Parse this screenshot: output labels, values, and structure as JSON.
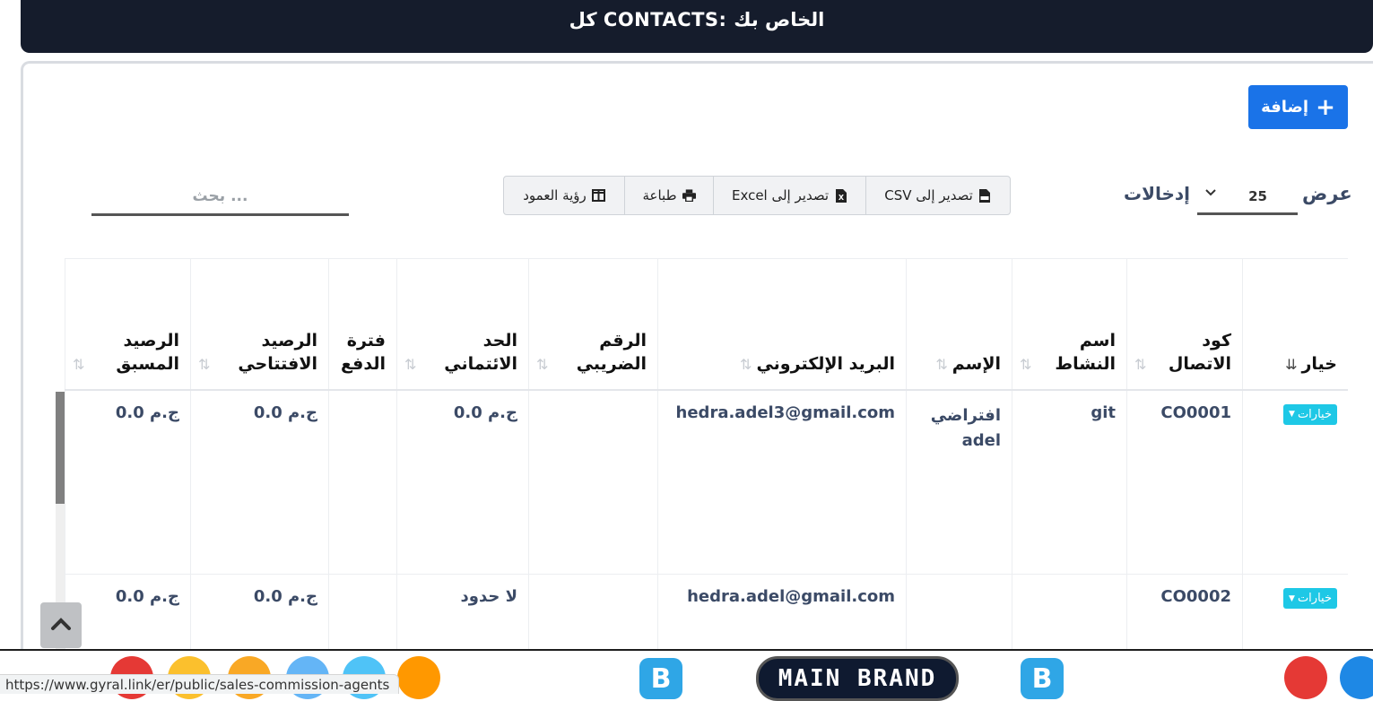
{
  "header": {
    "title": "كل CONTACTS: الخاص بك"
  },
  "toolbar": {
    "add_label": "إضافة",
    "show_label": "عرض",
    "entries_value": "25",
    "entries_label": "إدخالات",
    "export_csv": "تصدير إلى CSV",
    "export_excel": "تصدير إلى Excel",
    "print": "طباعة",
    "column_visibility": "رؤية العمود",
    "search_placeholder": "بحث ..."
  },
  "table": {
    "columns": [
      "خيار",
      "كود الاتصال",
      "اسم النشاط",
      "الإسم",
      "البريد الإلكتروني",
      "الرقم الضريبي",
      "الحد الائتماني",
      "فترة الدفع",
      "الرصيد الافتتاحي",
      "الرصيد المسبق"
    ],
    "options_label": "خيارات",
    "rows": [
      {
        "code": "CO0001",
        "business": "git",
        "name": "افتراضي adel",
        "email": "hedra.adel3@gmail.com",
        "tax": "",
        "credit": "ج.م 0.0",
        "pay_term": "",
        "opening": "ج.م 0.0",
        "advance": "ج.م 0.0"
      },
      {
        "code": "CO0002",
        "business": "",
        "name": "",
        "email": "hedra.adel@gmail.com",
        "tax": "",
        "credit": "لا حدود",
        "pay_term": "",
        "opening": "ج.م 0.0",
        "advance": "ج.م 0.0"
      }
    ]
  },
  "taskbar": {
    "brand": "MAIN BRAND",
    "b_letter": "B"
  },
  "status_url": "https://www.gyral.link/er/public/sales-commission-agents",
  "colors": {
    "header_bg": "#151c2c",
    "primary": "#1a73e8",
    "options_btn": "#1ec8e6",
    "text_muted": "#3b4a66"
  }
}
